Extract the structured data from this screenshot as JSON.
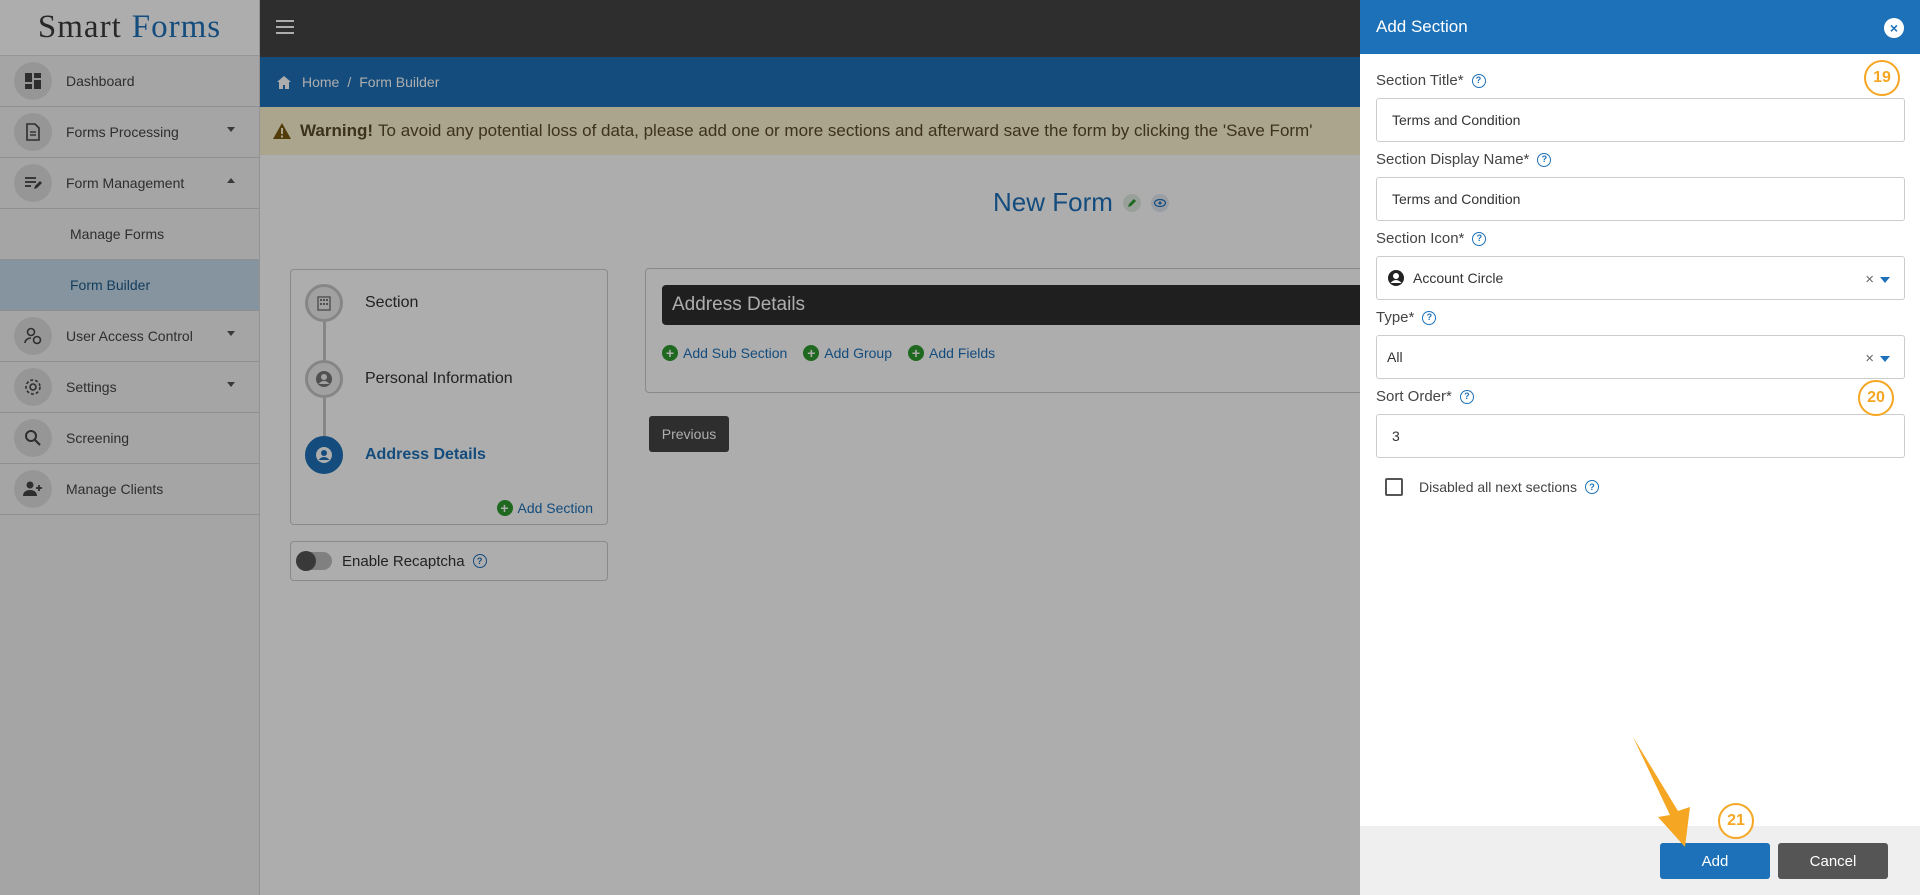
{
  "app": {
    "logo_smart": "Smart",
    "logo_forms": "Forms"
  },
  "sidebar": {
    "items": [
      {
        "label": "Dashboard",
        "icon": "dashboard-icon"
      },
      {
        "label": "Forms Processing",
        "icon": "document-icon"
      },
      {
        "label": "Form Management",
        "icon": "edit-list-icon"
      },
      {
        "label": "Manage Forms"
      },
      {
        "label": "Form Builder"
      },
      {
        "label": "User Access Control",
        "icon": "user-shield-icon"
      },
      {
        "label": "Settings",
        "icon": "gear-icon"
      },
      {
        "label": "Screening",
        "icon": "search-icon"
      },
      {
        "label": "Manage Clients",
        "icon": "user-add-icon"
      }
    ]
  },
  "breadcrumb": {
    "home": "Home",
    "separator": "/",
    "current": "Form Builder"
  },
  "warning": {
    "bold": "Warning!",
    "text": "To avoid any potential loss of data, please add one or more sections and afterward save the form by clicking the 'Save Form'"
  },
  "main": {
    "form_title": "New Form",
    "steps": [
      {
        "label": "Section",
        "icon": "building-icon"
      },
      {
        "label": "Personal Information",
        "icon": "account-circle-icon"
      },
      {
        "label": "Address Details",
        "icon": "account-circle-icon"
      }
    ],
    "add_section_link": "Add Section",
    "recaptcha_label": "Enable Recaptcha",
    "address_card_title": "Address Details",
    "actions": [
      "Add Sub Section",
      "Add Group",
      "Add Fields"
    ],
    "previous_button": "Previous"
  },
  "drawer": {
    "title": "Add Section",
    "section_title_label": "Section Title*",
    "section_title_value": "Terms and Condition",
    "display_name_label": "Section Display Name*",
    "display_name_value": "Terms and Condition",
    "icon_label": "Section Icon*",
    "icon_value": "Account Circle",
    "type_label": "Type*",
    "type_value": "All",
    "sort_order_label": "Sort Order*",
    "sort_order_value": "3",
    "checkbox_label": "Disabled all next sections",
    "add_button": "Add",
    "cancel_button": "Cancel",
    "clear_symbol": "×"
  },
  "callouts": [
    "19",
    "20",
    "21"
  ],
  "colors": {
    "primary": "#1d71b8",
    "callout": "#f5a623",
    "topbar": "#444444",
    "warning_bg": "#fdf3d1"
  }
}
